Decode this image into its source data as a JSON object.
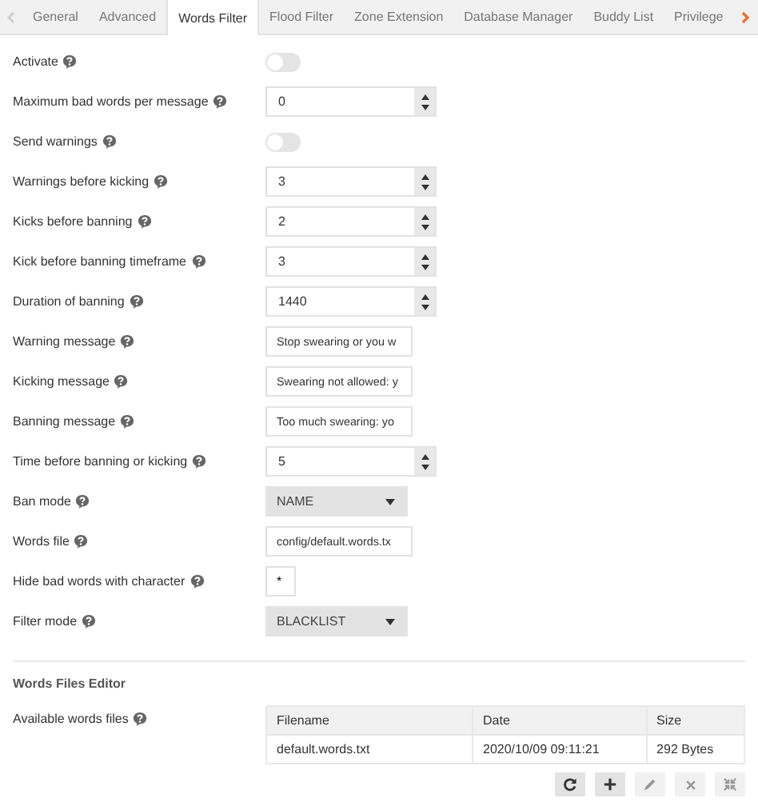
{
  "tabs": [
    {
      "label": "General",
      "selected": false
    },
    {
      "label": "Advanced",
      "selected": false
    },
    {
      "label": "Words Filter",
      "selected": true
    },
    {
      "label": "Flood Filter",
      "selected": false
    },
    {
      "label": "Zone Extension",
      "selected": false
    },
    {
      "label": "Database Manager",
      "selected": false
    },
    {
      "label": "Buddy List",
      "selected": false
    },
    {
      "label": "Privilege",
      "selected": false
    }
  ],
  "tab_scroll": {
    "prev_disabled": true,
    "next_disabled": false
  },
  "settings": [
    {
      "kind": "toggle",
      "label": "Activate",
      "on": false
    },
    {
      "kind": "number",
      "label": "Maximum bad words per message",
      "value": "0"
    },
    {
      "kind": "toggle",
      "label": "Send warnings",
      "on": false
    },
    {
      "kind": "number",
      "label": "Warnings before kicking",
      "value": "3"
    },
    {
      "kind": "number",
      "label": "Kicks before banning",
      "value": "2"
    },
    {
      "kind": "number",
      "label": "Kick before banning timeframe",
      "value": "3"
    },
    {
      "kind": "number",
      "label": "Duration of banning",
      "value": "1440"
    },
    {
      "kind": "text",
      "label": "Warning message",
      "value": "Stop swearing or you w"
    },
    {
      "kind": "text",
      "label": "Kicking message",
      "value": "Swearing not allowed: y"
    },
    {
      "kind": "text",
      "label": "Banning message",
      "value": "Too much swearing: yo"
    },
    {
      "kind": "number",
      "label": "Time before banning or kicking",
      "value": "5"
    },
    {
      "kind": "select",
      "label": "Ban mode",
      "value": "NAME"
    },
    {
      "kind": "text",
      "label": "Words file",
      "value": "config/default.words.tx"
    },
    {
      "kind": "char",
      "label": "Hide bad words with character",
      "value": "*"
    },
    {
      "kind": "select",
      "label": "Filter mode",
      "value": "BLACKLIST"
    }
  ],
  "editor": {
    "title": "Words Files Editor",
    "label": "Available words files",
    "table": {
      "columns": [
        "Filename",
        "Date",
        "Size"
      ],
      "rows": [
        [
          "default.words.txt",
          "2020/10/09 09:11:21",
          "292 Bytes"
        ]
      ]
    },
    "toolbar": [
      {
        "kind": "refresh",
        "disabled": false
      },
      {
        "kind": "add",
        "disabled": false
      },
      {
        "kind": "edit",
        "disabled": true
      },
      {
        "kind": "delete",
        "disabled": true
      },
      {
        "kind": "expand",
        "disabled": true
      }
    ]
  }
}
